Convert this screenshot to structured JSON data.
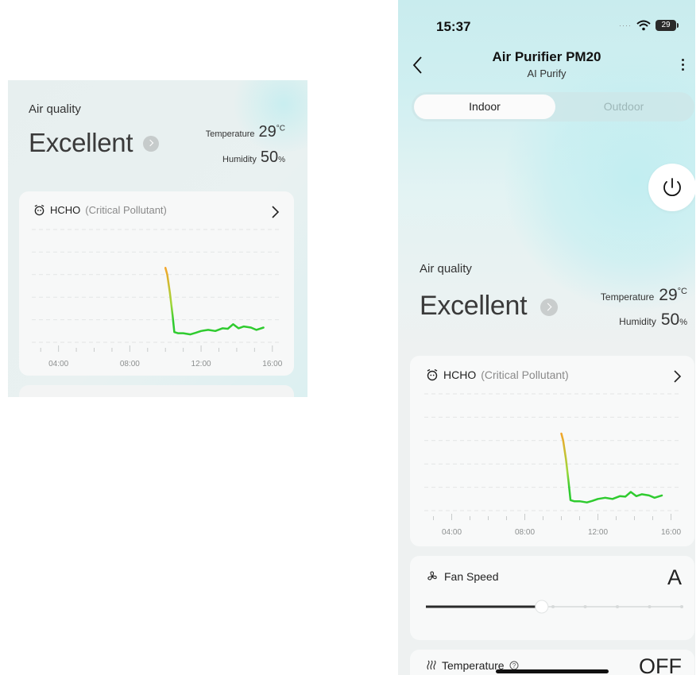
{
  "status_bar": {
    "time": "15:37",
    "battery": "29"
  },
  "nav": {
    "title": "Air Purifier PM20",
    "subtitle": "AI Purify"
  },
  "segmented": {
    "options": [
      "Indoor",
      "Outdoor"
    ],
    "selected": "Indoor"
  },
  "air_quality": {
    "label": "Air quality",
    "value": "Excellent",
    "temperature_label": "Temperature",
    "temperature_value": "29",
    "temperature_unit": "°C",
    "humidity_label": "Humidity",
    "humidity_value": "50",
    "humidity_unit": "%"
  },
  "pollutant_card": {
    "name": "HCHO",
    "qualifier": "(Critical Pollutant)",
    "x_ticks": [
      "04:00",
      "08:00",
      "12:00",
      "16:00"
    ]
  },
  "chart_data": {
    "type": "line",
    "title": "",
    "xlabel": "",
    "ylabel": "",
    "x_ticks": [
      "04:00",
      "08:00",
      "12:00",
      "16:00"
    ],
    "xlim": [
      2.5,
      16.5
    ],
    "ylim": [
      0,
      5
    ],
    "grid": true,
    "series": [
      {
        "x": [
          10.0,
          10.1,
          10.25,
          10.4,
          10.5,
          10.7,
          11.0,
          11.4,
          11.7,
          12.0,
          12.4,
          12.8,
          13.2,
          13.5,
          13.8,
          14.1,
          14.4,
          14.8,
          15.1,
          15.5
        ],
        "y": [
          3.3,
          3.0,
          2.2,
          1.2,
          0.45,
          0.4,
          0.4,
          0.35,
          0.42,
          0.5,
          0.55,
          0.5,
          0.62,
          0.6,
          0.8,
          0.62,
          0.7,
          0.65,
          0.55,
          0.65
        ],
        "colors": [
          "#f3a52a",
          "#9fd73a",
          "#2fcb2f"
        ]
      }
    ]
  },
  "fan": {
    "label": "Fan Speed",
    "value": "A",
    "level": 0.45,
    "steps": 8
  },
  "temperature_card": {
    "label": "Temperature",
    "value": "OFF"
  }
}
